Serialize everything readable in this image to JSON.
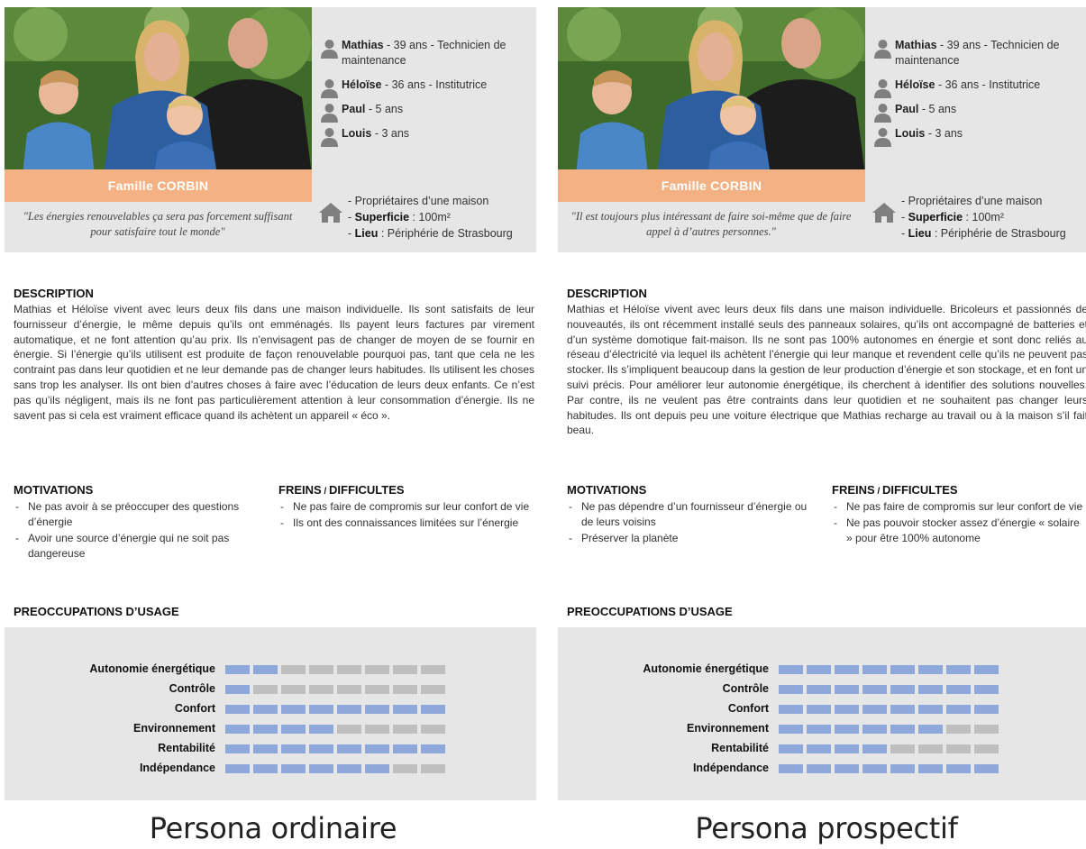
{
  "colors": {
    "filled": "#8fa8db",
    "empty": "#bfbfbf",
    "accent": "#f4b183",
    "card": "#e6e6e6"
  },
  "personas": [
    {
      "family": "Famille CORBIN",
      "members": [
        {
          "name": "Mathias",
          "detail": " - 39 ans - Technicien de maintenance"
        },
        {
          "name": "Héloïse",
          "detail": " - 36 ans - Institutrice"
        },
        {
          "name": "Paul",
          "detail": " - 5 ans"
        },
        {
          "name": "Louis",
          "detail": " - 3 ans"
        }
      ],
      "quote": "\"Les énergies renouvelables ça sera pas forcement suffisant pour satisfaire tout le monde\"",
      "home": {
        "line1": "- Propriétaires d’une maison",
        "surface_label": "Superficie",
        "surface_value": " : 100m²",
        "place_label": "Lieu",
        "place_value": " : Périphérie de Strasbourg"
      },
      "description_title": "DESCRIPTION",
      "description": "Mathias et Héloïse vivent avec leurs deux fils dans une maison individuelle. Ils sont satisfaits de leur fournisseur d’énergie, le même depuis qu’ils ont emménagés. Ils payent leurs factures par virement automatique, et ne font attention qu’au prix. Ils n’envisagent pas de changer de moyen de se fournir en énergie. Si l’énergie qu’ils utilisent est produite de façon renouvelable pourquoi pas, tant que cela ne les contraint pas dans leur quotidien et ne leur demande pas de changer leurs habitudes. Ils utilisent les choses sans trop les analyser. Ils ont bien d’autres choses à faire avec l’éducation de leurs deux enfants. Ce n’est pas qu’ils négligent, mais ils ne font pas particulièrement attention à leur consommation d’énergie. Ils ne savent pas si cela est vraiment efficace quand ils achètent un appareil « éco ».",
      "motivations_title": "MOTIVATIONS",
      "motivations": [
        "Ne pas avoir à se préoccuper des questions d’énergie",
        "Avoir une source d’énergie qui ne soit pas dangereuse"
      ],
      "freins_title_a": "FREINS",
      "freins_title_sep": " / ",
      "freins_title_b": "DIFFICULTES",
      "freins": [
        "Ne pas faire de compromis sur leur confort de vie",
        "Ils ont des connaissances limitées sur l’énergie"
      ],
      "usage_title": "PREOCCUPATIONS D’USAGE",
      "usage": [
        {
          "label": "Autonomie énergétique",
          "level": 2
        },
        {
          "label": "Contrôle",
          "level": 1
        },
        {
          "label": "Confort",
          "level": 8
        },
        {
          "label": "Environnement",
          "level": 4
        },
        {
          "label": "Rentabilité",
          "level": 8
        },
        {
          "label": "Indépendance",
          "level": 6
        }
      ],
      "usage_max": 8,
      "caption": "Persona ordinaire"
    },
    {
      "family": "Famille CORBIN",
      "members": [
        {
          "name": "Mathias",
          "detail": " - 39 ans - Technicien de maintenance"
        },
        {
          "name": "Héloïse",
          "detail": " - 36 ans - Institutrice"
        },
        {
          "name": "Paul",
          "detail": " - 5 ans"
        },
        {
          "name": "Louis",
          "detail": " - 3 ans"
        }
      ],
      "quote": "\"Il est toujours plus intéressant de faire soi-même que de faire appel à d’autres personnes.\"",
      "home": {
        "line1": "- Propriétaires d’une maison",
        "surface_label": "Superficie",
        "surface_value": " : 100m²",
        "place_label": "Lieu",
        "place_value": " : Périphérie de Strasbourg"
      },
      "description_title": "DESCRIPTION",
      "description": "Mathias et Héloïse vivent avec leurs deux fils dans une maison individuelle. Bricoleurs et passionnés de nouveautés, ils ont récemment installé seuls des panneaux solaires, qu’ils ont accompagné de batteries et d’un système domotique fait-maison. Ils ne sont pas 100% autonomes en énergie et sont donc reliés au réseau d’électricité via lequel ils achètent l’énergie qui leur manque et revendent celle qu’ils ne peuvent pas stocker. Ils s’impliquent beaucoup dans la gestion de leur production d’énergie et son stockage, et en font un suivi précis. Pour améliorer leur autonomie énergétique, ils cherchent à identifier des solutions nouvelles. Par contre, ils ne veulent pas être contraints dans leur quotidien et ne souhaitent pas changer leurs habitudes. Ils ont depuis peu une voiture électrique que Mathias recharge au travail ou à la maison s’il fait beau.",
      "motivations_title": "MOTIVATIONS",
      "motivations": [
        "Ne pas dépendre d’un fournisseur d’énergie ou de leurs voisins",
        "Préserver la planète"
      ],
      "freins_title_a": "FREINS",
      "freins_title_sep": " / ",
      "freins_title_b": "DIFFICULTES",
      "freins": [
        "Ne pas faire de compromis sur leur confort de vie",
        "Ne pas pouvoir stocker assez d’énergie « solaire » pour être 100% autonome"
      ],
      "usage_title": "PREOCCUPATIONS D’USAGE",
      "usage": [
        {
          "label": "Autonomie énergétique",
          "level": 8
        },
        {
          "label": "Contrôle",
          "level": 8
        },
        {
          "label": "Confort",
          "level": 8
        },
        {
          "label": "Environnement",
          "level": 6
        },
        {
          "label": "Rentabilité",
          "level": 4
        },
        {
          "label": "Indépendance",
          "level": 8
        }
      ],
      "usage_max": 8,
      "caption": "Persona prospectif"
    }
  ]
}
